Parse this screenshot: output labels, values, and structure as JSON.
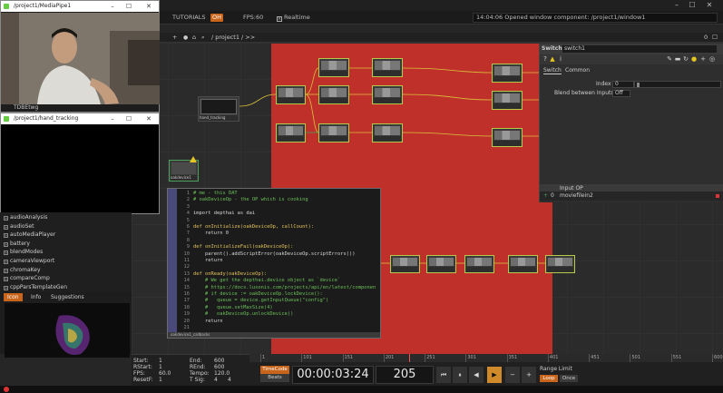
{
  "toolbar": {
    "tutorials": "TUTORIALS",
    "oh_badge": "OH",
    "fps_label": "FPS:",
    "fps_value": "60",
    "realtime": "Realtime",
    "realtime_check": "X",
    "status": "14:04:06 Opened window component: /project1/window1"
  },
  "path": {
    "plus": "+",
    "path": "/ project1 / >>",
    "zoom": "0"
  },
  "media_window": {
    "title": "/project1/MediaPipe1",
    "minimize": "–",
    "maximize": "☐",
    "close": "✕",
    "footer_label": "TDBEtwg"
  },
  "hand_window": {
    "title": "/project1/hand_tracking",
    "minimize": "–",
    "maximize": "☐",
    "close": "✕"
  },
  "palette": {
    "items": [
      "audioAnalysis",
      "audioSet",
      "autoMediaPlayer",
      "battery",
      "blendModes",
      "cameraViewport",
      "chromaKey",
      "compareComp",
      "cppParsTemplateGen"
    ]
  },
  "lower_tabs": [
    "Icon",
    "Info",
    "Suggestions"
  ],
  "nodes": {
    "hand_tracking": "hand_tracking",
    "oakdevice": "oakdevice1",
    "code_dat": "oakdevice1_callbacks"
  },
  "code_lines": [
    {
      "n": "1",
      "t": "# me - this DAT",
      "c": "cmt"
    },
    {
      "n": "2",
      "t": "# oakDeviceOp - the OP which is cooking",
      "c": "cmt"
    },
    {
      "n": "3",
      "t": "",
      "c": ""
    },
    {
      "n": "4",
      "t": "import depthai as dai",
      "c": ""
    },
    {
      "n": "5",
      "t": "",
      "c": ""
    },
    {
      "n": "6",
      "t": "def onInitialize(oakDeviceOp, callCount):",
      "c": "def"
    },
    {
      "n": "7",
      "t": "    return 0",
      "c": ""
    },
    {
      "n": "8",
      "t": "",
      "c": ""
    },
    {
      "n": "9",
      "t": "def onInitializeFail(oakDeviceOp):",
      "c": "def"
    },
    {
      "n": "10",
      "t": "    parent().addScriptError(oakDeviceOp.scriptErrors())",
      "c": ""
    },
    {
      "n": "11",
      "t": "    return",
      "c": ""
    },
    {
      "n": "12",
      "t": "",
      "c": ""
    },
    {
      "n": "13",
      "t": "def onReady(oakDeviceOp):",
      "c": "def"
    },
    {
      "n": "14",
      "t": "    # We get the depthai.device object as `device`",
      "c": "cmt"
    },
    {
      "n": "15",
      "t": "    # https://docs.luxonis.com/projects/api/en/latest/componen",
      "c": "cmt"
    },
    {
      "n": "16",
      "t": "    # if device := oakDeviceOp.lockDevice():",
      "c": "cmt"
    },
    {
      "n": "17",
      "t": "    #   queue = device.getInputQueue(\"config\")",
      "c": "cmt"
    },
    {
      "n": "18",
      "t": "    #   queue.setMaxSize(4)",
      "c": "cmt"
    },
    {
      "n": "19",
      "t": "    #   oakDeviceOp.unlockDevice()",
      "c": "cmt"
    },
    {
      "n": "20",
      "t": "    return",
      "c": ""
    },
    {
      "n": "21",
      "t": "",
      "c": ""
    }
  ],
  "params": {
    "op_type": "Switch",
    "op_name": "switch1",
    "tabs": [
      "Switch",
      "Common"
    ],
    "index_label": "Index",
    "index_value": "0",
    "blend_label": "Blend between Inputs",
    "blend_value": "Off",
    "input_head": "Input OP",
    "input_index": "0",
    "input_value": "moviefilein2"
  },
  "timeline": {
    "start_label": "Start:",
    "start_value": "1",
    "rstart_label": "RStart:",
    "rstart_value": "1",
    "fps_label": "FPS:",
    "fps_value": "60.0",
    "resetf_label": "ResetF:",
    "resetf_value": "1",
    "end_label": "End:",
    "end_value": "600",
    "rend_label": "REnd:",
    "rend_value": "600",
    "tempo_label": "Tempo:",
    "tempo_value": "120.0",
    "tsig_label": "T Sig:",
    "tsig_value_a": "4",
    "tsig_value_b": "4",
    "ticks": [
      "1",
      "101",
      "151",
      "201",
      "251",
      "301",
      "351",
      "401",
      "451",
      "501",
      "551",
      "600"
    ],
    "timecode_btn": "TimeCode",
    "beats_btn": "Beats",
    "timecode": "00:00:03:24",
    "frame": "205",
    "btn_start": "⏮",
    "btn_pause": "⏸",
    "btn_back": "◀",
    "btn_play": "▶",
    "btn_minus": "−",
    "btn_plus": "+",
    "range_label": "Range Limit",
    "loop": "Loop",
    "once": "Once"
  },
  "colors": {
    "accent": "#c9641b",
    "red_zone": "#c0302b"
  }
}
